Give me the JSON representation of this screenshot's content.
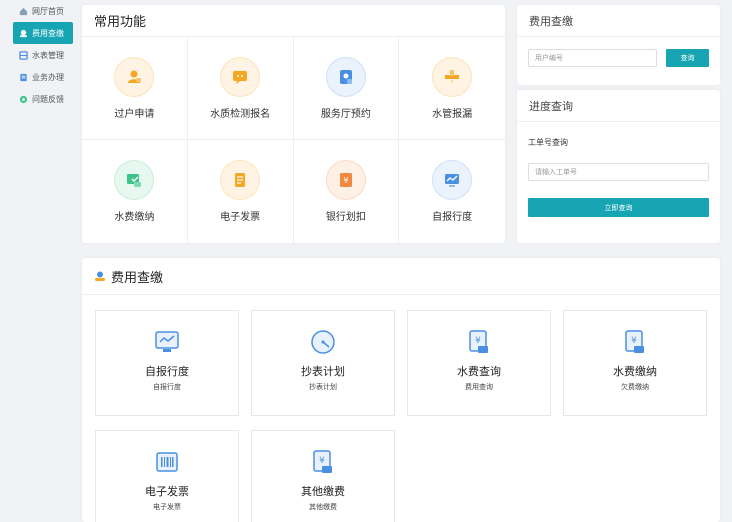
{
  "sidebar": {
    "items": [
      {
        "label": "网厅首页",
        "icon": "home-icon"
      },
      {
        "label": "费用查缴",
        "icon": "fee-icon"
      },
      {
        "label": "水表管理",
        "icon": "meter-icon"
      },
      {
        "label": "业务办理",
        "icon": "business-icon"
      },
      {
        "label": "问题反馈",
        "icon": "feedback-icon"
      }
    ]
  },
  "common": {
    "title": "常用功能",
    "items": [
      {
        "label": "过户申请",
        "icon": "transfer-user-icon"
      },
      {
        "label": "水质检测报名",
        "icon": "water-quality-icon"
      },
      {
        "label": "服务厅预约",
        "icon": "hall-booking-icon"
      },
      {
        "label": "水管报漏",
        "icon": "pipe-leak-icon"
      },
      {
        "label": "水费缴纳",
        "icon": "water-payment-icon"
      },
      {
        "label": "电子发票",
        "icon": "e-invoice-icon"
      },
      {
        "label": "银行划扣",
        "icon": "bank-deduct-icon"
      },
      {
        "label": "自报行度",
        "icon": "self-report-icon"
      }
    ]
  },
  "fee_query": {
    "title": "费用查缴",
    "placeholder": "用户编号",
    "button": "查询"
  },
  "progress": {
    "title": "进度查询",
    "label": "工单号查询",
    "placeholder": "请输入工单号",
    "button": "立即查询"
  },
  "fee_section": {
    "title": "费用查缴",
    "cards": [
      {
        "title": "自报行度",
        "sub": "自报行度",
        "icon": "monitor-icon"
      },
      {
        "title": "抄表计划",
        "sub": "抄表计划",
        "icon": "gauge-icon"
      },
      {
        "title": "水费查询",
        "sub": "费用查询",
        "icon": "bill-search-icon"
      },
      {
        "title": "水费缴纳",
        "sub": "欠费缴纳",
        "icon": "bill-pay-icon"
      },
      {
        "title": "电子发票",
        "sub": "电子发票",
        "icon": "barcode-invoice-icon"
      },
      {
        "title": "其他缴费",
        "sub": "其他缴费",
        "icon": "other-payment-icon"
      }
    ]
  },
  "colors": {
    "accent": "#17a5b3",
    "orange": "#f5a623",
    "blue": "#4a90e2",
    "green": "#3cc48a"
  }
}
